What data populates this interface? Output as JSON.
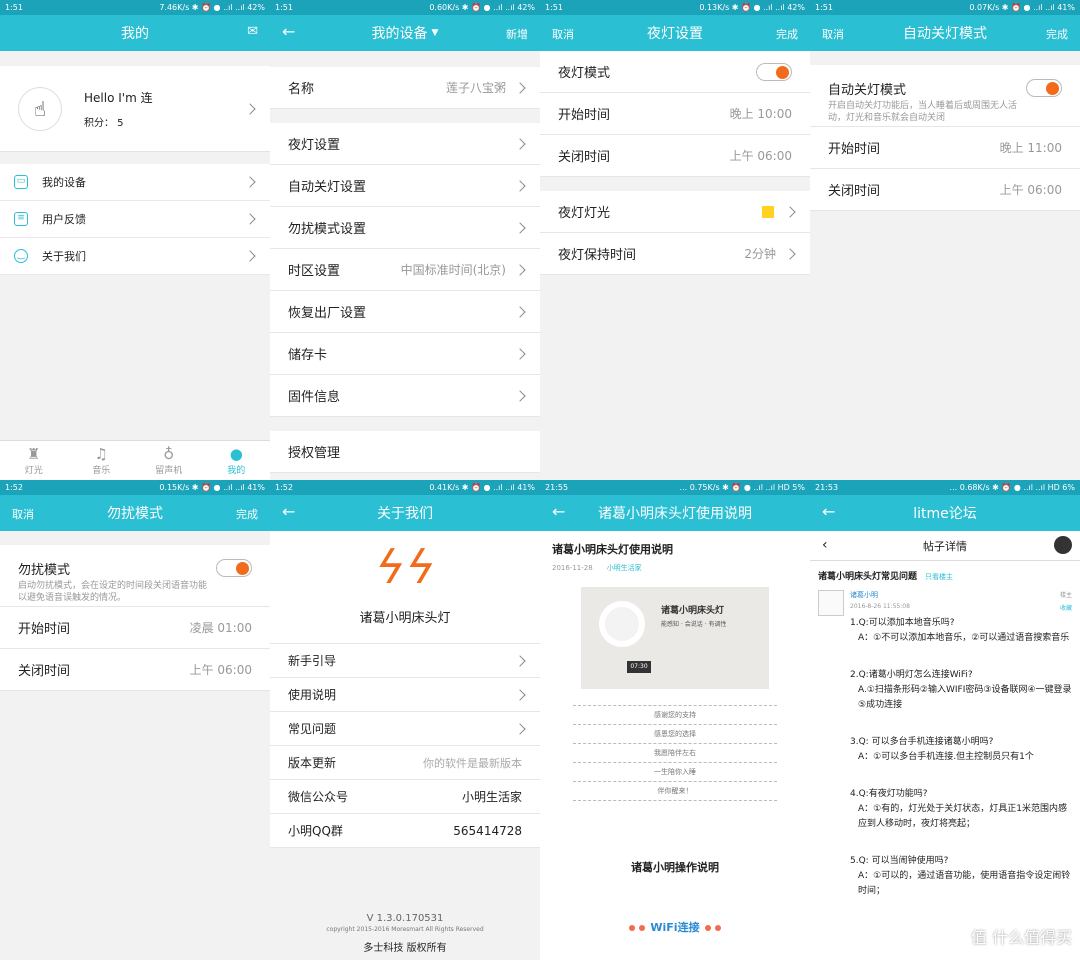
{
  "p1": {
    "status": {
      "time": "1:51",
      "info": "7.46K/s ✱ ⏰ ● ..ıl ..ıl 42%"
    },
    "title": "我的",
    "avatar_text": "☝",
    "name": "Hello I'm 连",
    "points": "积分： 5",
    "menu": [
      "我的设备",
      "用户反馈",
      "关于我们"
    ],
    "tabs": [
      "灯光",
      "音乐",
      "留声机",
      "我的"
    ]
  },
  "p2": {
    "status": {
      "time": "1:51",
      "info": "0.60K/s ✱ ⏰ ● ..ıl ..ıl 42%"
    },
    "title": "我的设备",
    "right": "新增",
    "rows": [
      {
        "label": "名称",
        "value": "莲子八宝粥"
      },
      {
        "label": "夜灯设置",
        "value": ""
      },
      {
        "label": "自动关灯设置",
        "value": ""
      },
      {
        "label": "勿扰模式设置",
        "value": ""
      },
      {
        "label": "时区设置",
        "value": "中国标准时间(北京)"
      },
      {
        "label": "恢复出厂设置",
        "value": ""
      },
      {
        "label": "储存卡",
        "value": ""
      },
      {
        "label": "固件信息",
        "value": ""
      },
      {
        "label": "授权管理",
        "value": ""
      }
    ]
  },
  "p3": {
    "status": {
      "time": "1:51",
      "info": "0.13K/s ✱ ⏰ ● ..ıl ..ıl 42%"
    },
    "left": "取消",
    "title": "夜灯设置",
    "right": "完成",
    "mode": "夜灯模式",
    "start": "开始时间",
    "start_v": "晚上 10:00",
    "end": "关闭时间",
    "end_v": "上午 06:00",
    "light": "夜灯灯光",
    "hold": "夜灯保持时间",
    "hold_v": "2分钟",
    "light_color": "#ffd21f"
  },
  "p4": {
    "status": {
      "time": "1:51",
      "info": "0.07K/s ✱ ⏰ ● ..ıl ..ıl 41%"
    },
    "left": "取消",
    "title": "自动关灯模式",
    "right": "完成",
    "mode": "自动关灯模式",
    "desc": "开启自动关灯功能后，当人睡着后或周围无人活动，灯光和音乐就会自动关闭",
    "start": "开始时间",
    "start_v": "晚上 11:00",
    "end": "关闭时间",
    "end_v": "上午 06:00"
  },
  "p5": {
    "status": {
      "time": "1:52",
      "info": "0.15K/s ✱ ⏰ ● ..ıl ..ıl 41%"
    },
    "left": "取消",
    "title": "勿扰模式",
    "right": "完成",
    "mode": "勿扰模式",
    "desc": "启动勿扰模式，会在设定的时间段关闭语音功能以避免语音误触发的情况。",
    "start": "开始时间",
    "start_v": "凌晨 01:00",
    "end": "关闭时间",
    "end_v": "上午 06:00"
  },
  "p6": {
    "status": {
      "time": "1:52",
      "info": "0.41K/s ✱ ⏰ ● ..ıl ..ıl 41%"
    },
    "title": "关于我们",
    "logo": "ϟ",
    "appname": "诸葛小明床头灯",
    "rows": [
      {
        "label": "新手引导",
        "value": ""
      },
      {
        "label": "使用说明",
        "value": ""
      },
      {
        "label": "常见问题",
        "value": ""
      },
      {
        "label": "版本更新",
        "value": "你的软件是最新版本"
      },
      {
        "label": "微信公众号",
        "value": "小明生活家"
      },
      {
        "label": "小明QQ群",
        "value": "565414728"
      }
    ],
    "version": "V 1.3.0.170531",
    "copyright": "copyright 2015-2016 Moresmart All Rights Reserved",
    "company": "多士科技 版权所有"
  },
  "p7": {
    "status": {
      "time": "21:55",
      "info": "... 0.75K/s ✱ ⏰ ● ..ıl ..ıl HD 5%"
    },
    "title": "诸葛小明床头灯使用说明",
    "h1": "诸葛小明床头灯使用说明",
    "date": "2016-11-28",
    "source": "小明生活家",
    "hero_title": "诸葛小明床头灯",
    "hero_sub": "能感知 · 会说话 · 有调性",
    "clock": "07:30",
    "lines": [
      "感谢您的支持",
      "感恩您的选择",
      "我愿陪伴左右",
      "一生陪你入睡",
      "伴你醒来！"
    ],
    "h2": "诸葛小明操作说明",
    "wifi": "WiFi连接"
  },
  "p8": {
    "status": {
      "time": "21:53",
      "info": "... 0.68K/s ✱ ⏰ ● ..ıl ..ıl HD 6%"
    },
    "title": "litme论坛",
    "sub": "帖子详情",
    "ptitle": "诸葛小明床头灯常见问题",
    "only": "只看楼主",
    "user": "诸葛小明",
    "date": "2016-8-26 11:55:08",
    "floor": "楼主",
    "fav": "收藏",
    "qa": [
      {
        "q": "1.Q:可以添加本地音乐吗?",
        "a": "A：①不可以添加本地音乐，②可以通过语音搜索音乐"
      },
      {
        "q": "2.Q:诸葛小明灯怎么连接WiFi?",
        "a": "A.①扫描条形码②输入WIFI密码③设备联网④一键登录⑤成功连接"
      },
      {
        "q": "3.Q: 可以多台手机连接诸葛小明吗?",
        "a": "A：①可以多台手机连接.但主控制员只有1个"
      },
      {
        "q": "4.Q:有夜灯功能吗?",
        "a": "A：①有的，灯光处于关灯状态，灯具正1米范围内感应到人移动时，夜灯将亮起；"
      },
      {
        "q": "5.Q: 可以当闹钟使用吗?",
        "a": "A：①可以的，通过语音功能，使用语音指令设定闹铃时间；"
      }
    ],
    "watermark": "值 什么值得买"
  }
}
